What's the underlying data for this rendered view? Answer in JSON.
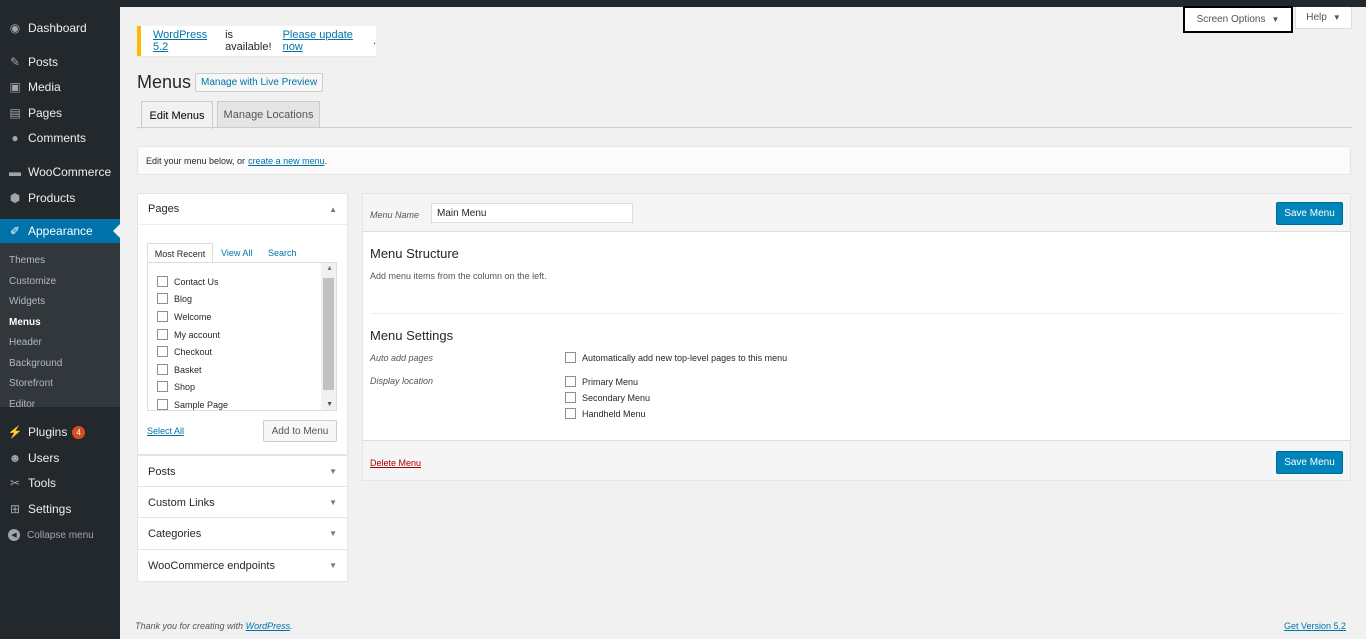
{
  "sidebar": {
    "dashboard": "Dashboard",
    "posts": "Posts",
    "media": "Media",
    "pages": "Pages",
    "comments": "Comments",
    "woocommerce": "WooCommerce",
    "products": "Products",
    "appearance": "Appearance",
    "submenu": [
      "Themes",
      "Customize",
      "Widgets",
      "Menus",
      "Header",
      "Background",
      "Storefront",
      "Editor"
    ],
    "plugins": "Plugins",
    "plugins_badge": "4",
    "users": "Users",
    "tools": "Tools",
    "settings": "Settings",
    "collapse": "Collapse menu"
  },
  "top": {
    "screen_options": "Screen Options",
    "help": "Help"
  },
  "notice": {
    "version_link": "WordPress 5.2",
    "middle": "is available!",
    "update_link": "Please update now",
    "end": "."
  },
  "header": {
    "title": "Menus",
    "live_preview": "Manage with Live Preview",
    "tab_edit": "Edit Menus",
    "tab_locations": "Manage Locations"
  },
  "manage": {
    "text": "Edit your menu below, or",
    "link": "create a new menu",
    "end": "."
  },
  "pages_box": {
    "title": "Pages",
    "tabs": [
      "Most Recent",
      "View All",
      "Search"
    ],
    "items": [
      "Contact Us",
      "Blog",
      "Welcome",
      "My account",
      "Checkout",
      "Basket",
      "Shop",
      "Sample Page"
    ],
    "select_all": "Select All",
    "add_button": "Add to Menu"
  },
  "accordion": {
    "posts": "Posts",
    "custom_links": "Custom Links",
    "categories": "Categories",
    "woo_endpoints": "WooCommerce endpoints"
  },
  "menu_panel": {
    "name_label": "Menu Name",
    "name_value": "Main Menu",
    "save": "Save Menu",
    "structure_title": "Menu Structure",
    "structure_hint": "Add menu items from the column on the left.",
    "settings_title": "Menu Settings",
    "auto_add_label": "Auto add pages",
    "auto_add_option": "Automatically add new top-level pages to this menu",
    "location_label": "Display location",
    "locations": [
      "Primary Menu",
      "Secondary Menu",
      "Handheld Menu"
    ],
    "delete": "Delete Menu"
  },
  "footer": {
    "thanks": "Thank you for creating with",
    "wp_link": "WordPress",
    "thanks_end": ".",
    "version": "Get Version 5.2"
  },
  "colors": {
    "sidebar_bg": "#23282d",
    "accent": "#0073aa",
    "primary_button": "#0085ba",
    "notice_border": "#ffb900",
    "delete": "#aa0000"
  }
}
